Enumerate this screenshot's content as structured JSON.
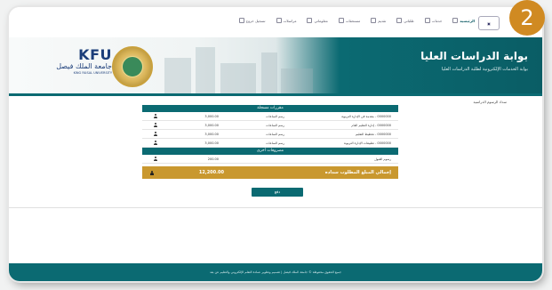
{
  "step_badge": "2",
  "nav": {
    "items": [
      {
        "label": "الرئيسية",
        "active": true
      },
      {
        "label": "خدمات"
      },
      {
        "label": "طلباتي"
      },
      {
        "label": "تقديم"
      },
      {
        "label": "مستحقات"
      },
      {
        "label": "معلوماتي"
      },
      {
        "label": "مراسلات"
      },
      {
        "label": "تسجيل خروج"
      }
    ]
  },
  "banner": {
    "title": "بوابة الدراسات العليا",
    "subtitle": "بوابة الخدمات الإلكترونية لطلبة الدراسات العليا",
    "kfu_abbr": "KFU",
    "kfu_arabic": "جامعة الملك فيصل",
    "kfu_english": "KING FAISAL UNIVERSITY"
  },
  "breadcrumb": "سداد الرسوم الدراسية",
  "fees": {
    "section1_header": "مقررات مسجلة",
    "rows": [
      {
        "name": "0000000 - مقدمة في الإدارة التربوية",
        "category": "رسم الساعات",
        "amount": "3,000.00"
      },
      {
        "name": "0000000 - إدارة التعليم العام",
        "category": "رسم الساعات",
        "amount": "3,000.00"
      },
      {
        "name": "0000000 - تخطيط التعليم",
        "category": "رسم الساعات",
        "amount": "3,000.00"
      },
      {
        "name": "0000000 - تطبيقات الإدارة التربوية",
        "category": "رسم الساعات",
        "amount": "3,000.00"
      }
    ],
    "section2_header": "مصروفات أخرى",
    "other_rows": [
      {
        "name": "رسوم القبول",
        "category": "",
        "amount": "200.00"
      }
    ],
    "total_label": "إجمالي المبلغ المطلوب سداده",
    "total_amount": "12,200.00"
  },
  "pay_button": "دفع",
  "footer": "جميع الحقوق محفوظة © جامعة الملك فيصل | تصميم وتطوير عمادة التعلم الإلكتروني والتعليم عن بعد"
}
